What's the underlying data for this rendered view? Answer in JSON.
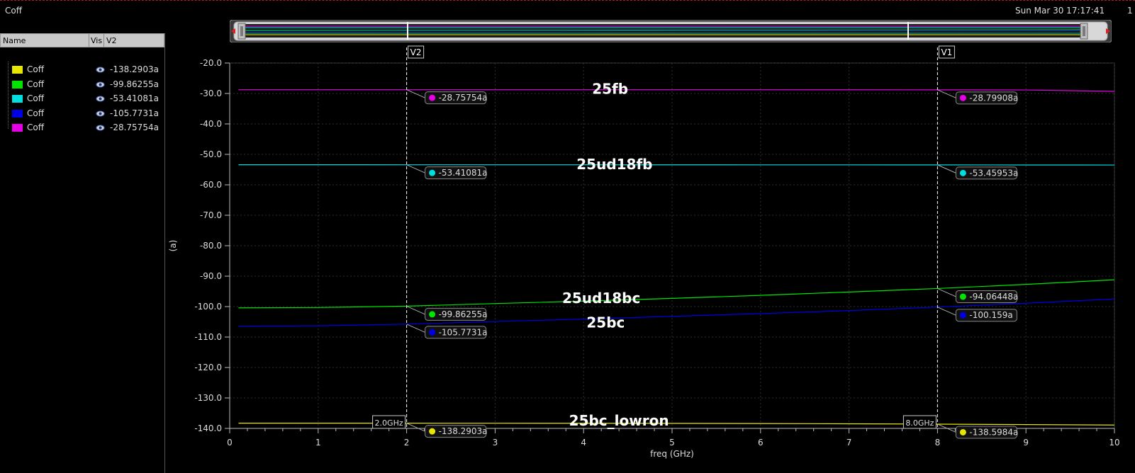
{
  "window": {
    "title": "Coff",
    "datetime": "Sun Mar 30 17:17:41",
    "corner": "1"
  },
  "panel": {
    "headers": {
      "name": "Name",
      "vis": "Vis",
      "v2": "V2"
    },
    "rows": [
      {
        "name": "Coff",
        "color": "#e6e600",
        "value": "-138.2903a"
      },
      {
        "name": "Coff",
        "color": "#00e600",
        "value": "-99.86255a"
      },
      {
        "name": "Coff",
        "color": "#00dede",
        "value": "-53.41081a"
      },
      {
        "name": "Coff",
        "color": "#0000e6",
        "value": "-105.7731a"
      },
      {
        "name": "Coff",
        "color": "#e600e6",
        "value": "-28.75754a"
      }
    ]
  },
  "chart_data": {
    "type": "line",
    "xlabel": "freq (GHz)",
    "ylabel": "(a)",
    "xlim": [
      0,
      10
    ],
    "ylim": [
      -140,
      -20
    ],
    "x_ticks": [
      "0",
      "1",
      "2",
      "3",
      "4",
      "5",
      "6",
      "7",
      "8",
      "9",
      "10"
    ],
    "y_ticks": [
      "-20.0",
      "-30.0",
      "-40.0",
      "-50.0",
      "-60.0",
      "-70.0",
      "-80.0",
      "-90.0",
      "-100.0",
      "-110.0",
      "-120.0",
      "-130.0",
      "-140.0"
    ],
    "grid": true,
    "series": [
      {
        "name": "25fb",
        "color": "#e600e6",
        "x": [
          0.1,
          1,
          2,
          3,
          4,
          5,
          6,
          7,
          8,
          9,
          10
        ],
        "y": [
          -28.76,
          -28.76,
          -28.76,
          -28.76,
          -28.76,
          -28.77,
          -28.77,
          -28.78,
          -28.8,
          -28.85,
          -29.3
        ]
      },
      {
        "name": "25ud18fb",
        "color": "#00dede",
        "x": [
          0.1,
          1,
          2,
          3,
          4,
          5,
          6,
          7,
          8,
          9,
          10
        ],
        "y": [
          -53.4,
          -53.4,
          -53.41,
          -53.41,
          -53.42,
          -53.43,
          -53.44,
          -53.45,
          -53.46,
          -53.48,
          -53.5
        ]
      },
      {
        "name": "25ud18bc",
        "color": "#00e600",
        "x": [
          0.1,
          1,
          2,
          3,
          4,
          5,
          6,
          7,
          8,
          9,
          10
        ],
        "y": [
          -100.4,
          -100.3,
          -99.86,
          -99.0,
          -98.2,
          -97.3,
          -96.3,
          -95.2,
          -94.06,
          -92.7,
          -91.2
        ]
      },
      {
        "name": "25bc",
        "color": "#0000e6",
        "x": [
          0.1,
          1,
          2,
          3,
          4,
          5,
          6,
          7,
          8,
          9,
          10
        ],
        "y": [
          -106.4,
          -106.3,
          -105.77,
          -104.9,
          -104.1,
          -103.2,
          -102.3,
          -101.3,
          -100.16,
          -98.9,
          -97.5
        ]
      },
      {
        "name": "25bc_lowron",
        "color": "#e6e600",
        "x": [
          0.1,
          1,
          2,
          3,
          4,
          5,
          6,
          7,
          8,
          9,
          10
        ],
        "y": [
          -138.29,
          -138.29,
          -138.29,
          -138.3,
          -138.32,
          -138.35,
          -138.4,
          -138.48,
          -138.6,
          -138.75,
          -138.9
        ]
      }
    ],
    "series_labels": [
      {
        "text": "25fb",
        "x": 4.3,
        "y": -28.5
      },
      {
        "text": "25ud18fb",
        "x": 4.35,
        "y": -53.2
      },
      {
        "text": "25ud18bc",
        "x": 4.2,
        "y": -97.2
      },
      {
        "text": "25bc",
        "x": 4.25,
        "y": -105.2
      },
      {
        "text": "25bc_lowron",
        "x": 4.4,
        "y": -137.4
      }
    ],
    "markers": [
      {
        "name": "V2",
        "x": 2.0,
        "x_label": "2.0GHz",
        "readouts": [
          {
            "color": "#e600e6",
            "value": "-28.75754a",
            "y": -28.76
          },
          {
            "color": "#00dede",
            "value": "-53.41081a",
            "y": -53.41
          },
          {
            "color": "#00e600",
            "value": "-99.86255a",
            "y": -99.86
          },
          {
            "color": "#0000e6",
            "value": "-105.7731a",
            "y": -105.77
          },
          {
            "color": "#e6e600",
            "value": "-138.2903a",
            "y": -138.29
          }
        ]
      },
      {
        "name": "V1",
        "x": 8.0,
        "x_label": "8.0GHz",
        "readouts": [
          {
            "color": "#e600e6",
            "value": "-28.79908a",
            "y": -28.8
          },
          {
            "color": "#00dede",
            "value": "-53.45953a",
            "y": -53.46
          },
          {
            "color": "#00e600",
            "value": "-94.06448a",
            "y": -94.06
          },
          {
            "color": "#0000e6",
            "value": "-100.159a",
            "y": -100.16
          },
          {
            "color": "#e6e600",
            "value": "-138.5984a",
            "y": -138.6
          }
        ]
      }
    ]
  }
}
